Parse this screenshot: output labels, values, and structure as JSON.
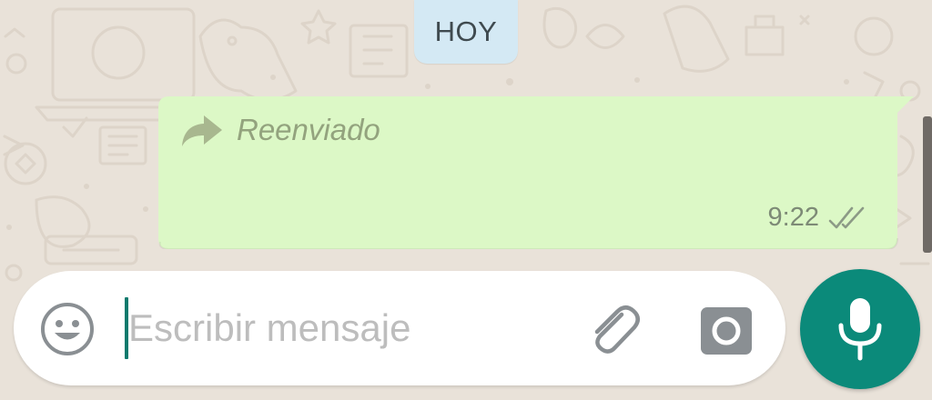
{
  "chat": {
    "date_separator": "HOY"
  },
  "message": {
    "forwarded_label": "Reenviado",
    "time": "9:22",
    "status": "delivered",
    "bubble_color": "#dcf8c6"
  },
  "composer": {
    "placeholder": "Escribir mensaje",
    "value": ""
  },
  "icons": {
    "emoji": "emoji-icon",
    "attach": "paperclip-icon",
    "camera": "camera-icon",
    "mic": "microphone-icon",
    "forward": "forward-arrow-icon",
    "ticks": "double-check-icon"
  },
  "colors": {
    "wallpaper": "#e9e2d9",
    "accent": "#0b8a7a",
    "date_pill": "#d4e9f4"
  }
}
